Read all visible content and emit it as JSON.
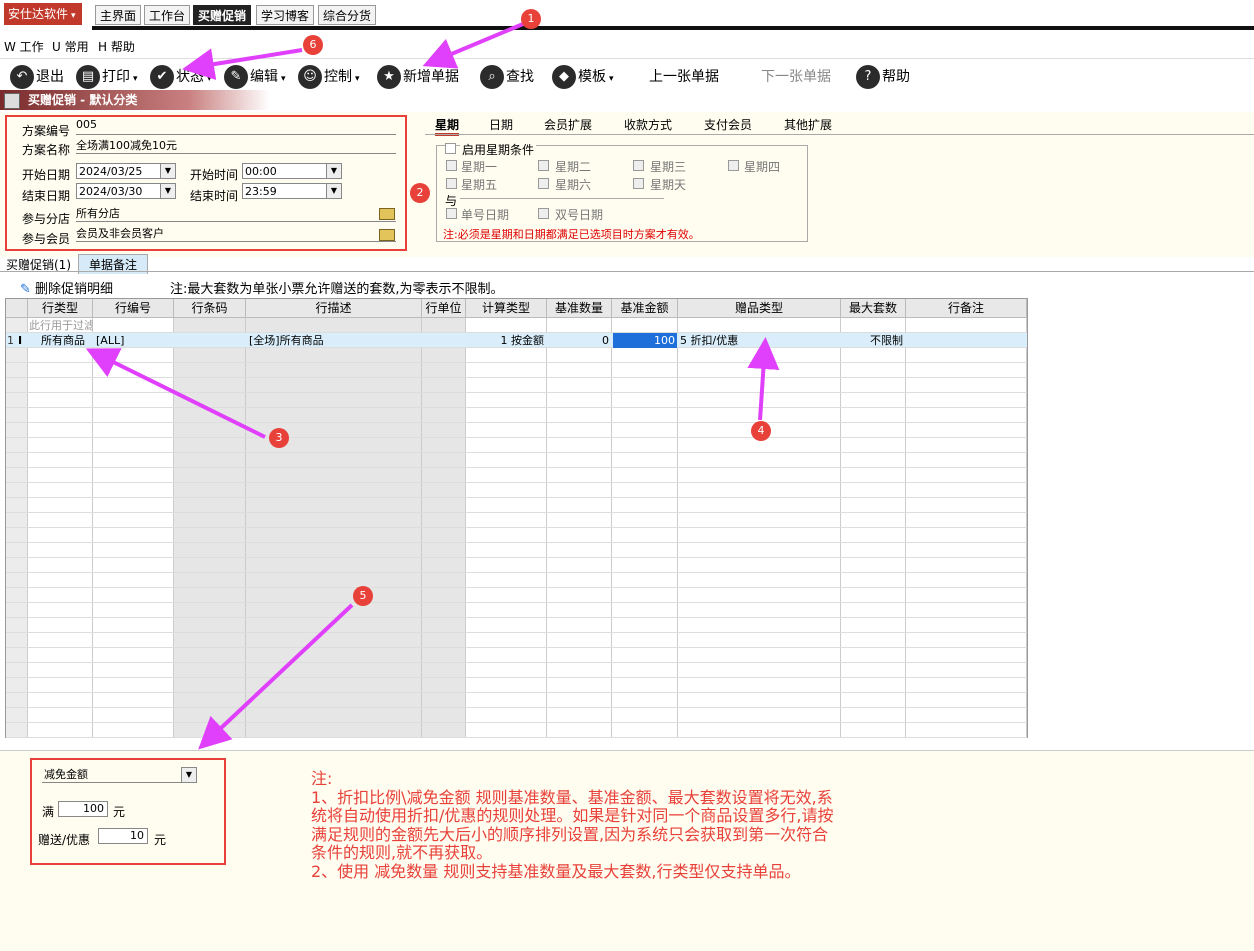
{
  "app": {
    "brand": "安仕达软件",
    "brand_caret": "▾"
  },
  "top_tabs": [
    "主界面",
    "工作台",
    "买赠促销",
    "学习博客",
    "综合分货"
  ],
  "menu": [
    "W 工作",
    "U 常用",
    "H 帮助"
  ],
  "toolbar": {
    "exit": "退出",
    "print": "打印",
    "status": "状态",
    "edit": "编辑",
    "control": "控制",
    "add": "新增单据",
    "find": "查找",
    "template": "模板",
    "prev": "上一张单据",
    "next": "下一张单据",
    "help": "帮助",
    "caret": "▾"
  },
  "section_title": "买赠促销 - 默认分类",
  "form": {
    "plan_no_label": "方案编号",
    "plan_no": "005",
    "plan_name_label": "方案名称",
    "plan_name": "全场满100减免10元",
    "start_date_label": "开始日期",
    "start_date": "2024/03/25",
    "start_time_label": "开始时间",
    "start_time": "00:00",
    "end_date_label": "结束日期",
    "end_date": "2024/03/30",
    "end_time_label": "结束时间",
    "end_time": "23:59",
    "branch_label": "参与分店",
    "branch": "所有分店",
    "member_label": "参与会员",
    "member": "会员及非会员客户"
  },
  "right_tabs": [
    "星期",
    "日期",
    "会员扩展",
    "收款方式",
    "支付会员",
    "其他扩展"
  ],
  "week": {
    "enable": "启用星期条件",
    "days": [
      "星期一",
      "星期二",
      "星期三",
      "星期四",
      "星期五",
      "星期六",
      "星期天"
    ],
    "and": "与",
    "odd": "单号日期",
    "even": "双号日期",
    "note": "注:必须是星期和日期都满足已选项目时方案才有效。"
  },
  "sub_tabs": [
    "买赠促销(1)",
    "单据备注"
  ],
  "detail": {
    "delete_btn": "删除促销明细",
    "note": "注:最大套数为单张小票允许赠送的套数,为零表示不限制。"
  },
  "grid": {
    "headers": [
      "行类型",
      "行编号",
      "行条码",
      "行描述",
      "行单位",
      "计算类型",
      "基准数量",
      "基准金额",
      "赠品类型",
      "最大套数",
      "行备注"
    ],
    "filter_placeholder": "此行用于过滤",
    "row": {
      "num": "1",
      "marker": "I",
      "type": "所有商品",
      "code": "[ALL]",
      "barcode": "",
      "desc": "[全场]所有商品",
      "unit": "",
      "calc": "1 按金额",
      "qty": "0",
      "amount": "100",
      "gift": "5 折扣/优惠",
      "max": "不限制",
      "remark": ""
    }
  },
  "bottom": {
    "mode": "减免金额",
    "full_label": "满",
    "full_value": "100",
    "yuan1": "元",
    "gift_label": "赠送/优惠",
    "gift_value": "10",
    "yuan2": "元"
  },
  "bignote": "注:\n1、折扣比例\\减免金额 规则基准数量、基准金额、最大套数设置将无效,系统将自动使用折扣/优惠的规则处理。如果是针对同一个商品设置多行,请按满足规则的金额先大后小的顺序排列设置,因为系统只会获取到第一次符合条件的规则,就不再获取。\n2、使用 减免数量 规则支持基准数量及最大套数,行类型仅支持单品。",
  "annotations": [
    "1",
    "2",
    "3",
    "4",
    "5",
    "6"
  ],
  "colors": {
    "accent": "#e8413a",
    "brand": "#c0392b",
    "selected_cell": "#1e6fd9",
    "row_highlight": "#d9eefa"
  }
}
